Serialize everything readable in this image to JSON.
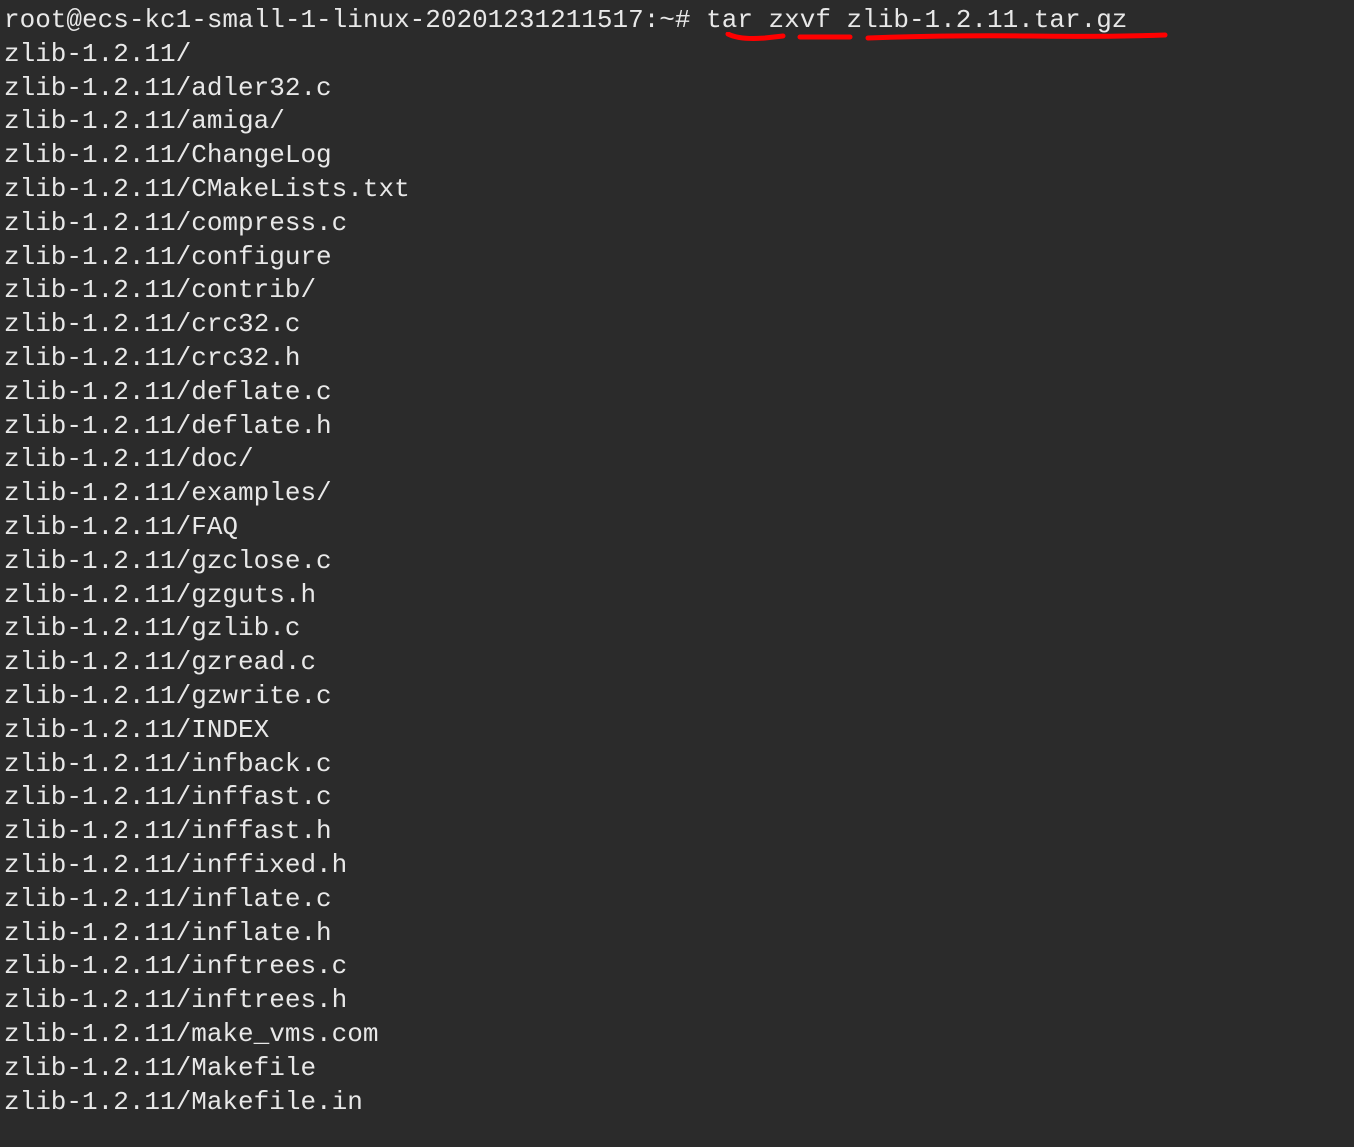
{
  "prompt": "root@ecs-kc1-small-1-linux-20201231211517:~# ",
  "command": "tar zxvf zlib-1.2.11.tar.gz",
  "output_lines": [
    "zlib-1.2.11/",
    "zlib-1.2.11/adler32.c",
    "zlib-1.2.11/amiga/",
    "zlib-1.2.11/ChangeLog",
    "zlib-1.2.11/CMakeLists.txt",
    "zlib-1.2.11/compress.c",
    "zlib-1.2.11/configure",
    "zlib-1.2.11/contrib/",
    "zlib-1.2.11/crc32.c",
    "zlib-1.2.11/crc32.h",
    "zlib-1.2.11/deflate.c",
    "zlib-1.2.11/deflate.h",
    "zlib-1.2.11/doc/",
    "zlib-1.2.11/examples/",
    "zlib-1.2.11/FAQ",
    "zlib-1.2.11/gzclose.c",
    "zlib-1.2.11/gzguts.h",
    "zlib-1.2.11/gzlib.c",
    "zlib-1.2.11/gzread.c",
    "zlib-1.2.11/gzwrite.c",
    "zlib-1.2.11/INDEX",
    "zlib-1.2.11/infback.c",
    "zlib-1.2.11/inffast.c",
    "zlib-1.2.11/inffast.h",
    "zlib-1.2.11/inffixed.h",
    "zlib-1.2.11/inflate.c",
    "zlib-1.2.11/inflate.h",
    "zlib-1.2.11/inftrees.c",
    "zlib-1.2.11/inftrees.h",
    "zlib-1.2.11/make_vms.com",
    "zlib-1.2.11/Makefile",
    "zlib-1.2.11/Makefile.in"
  ],
  "annotation_color": "#ff0000"
}
